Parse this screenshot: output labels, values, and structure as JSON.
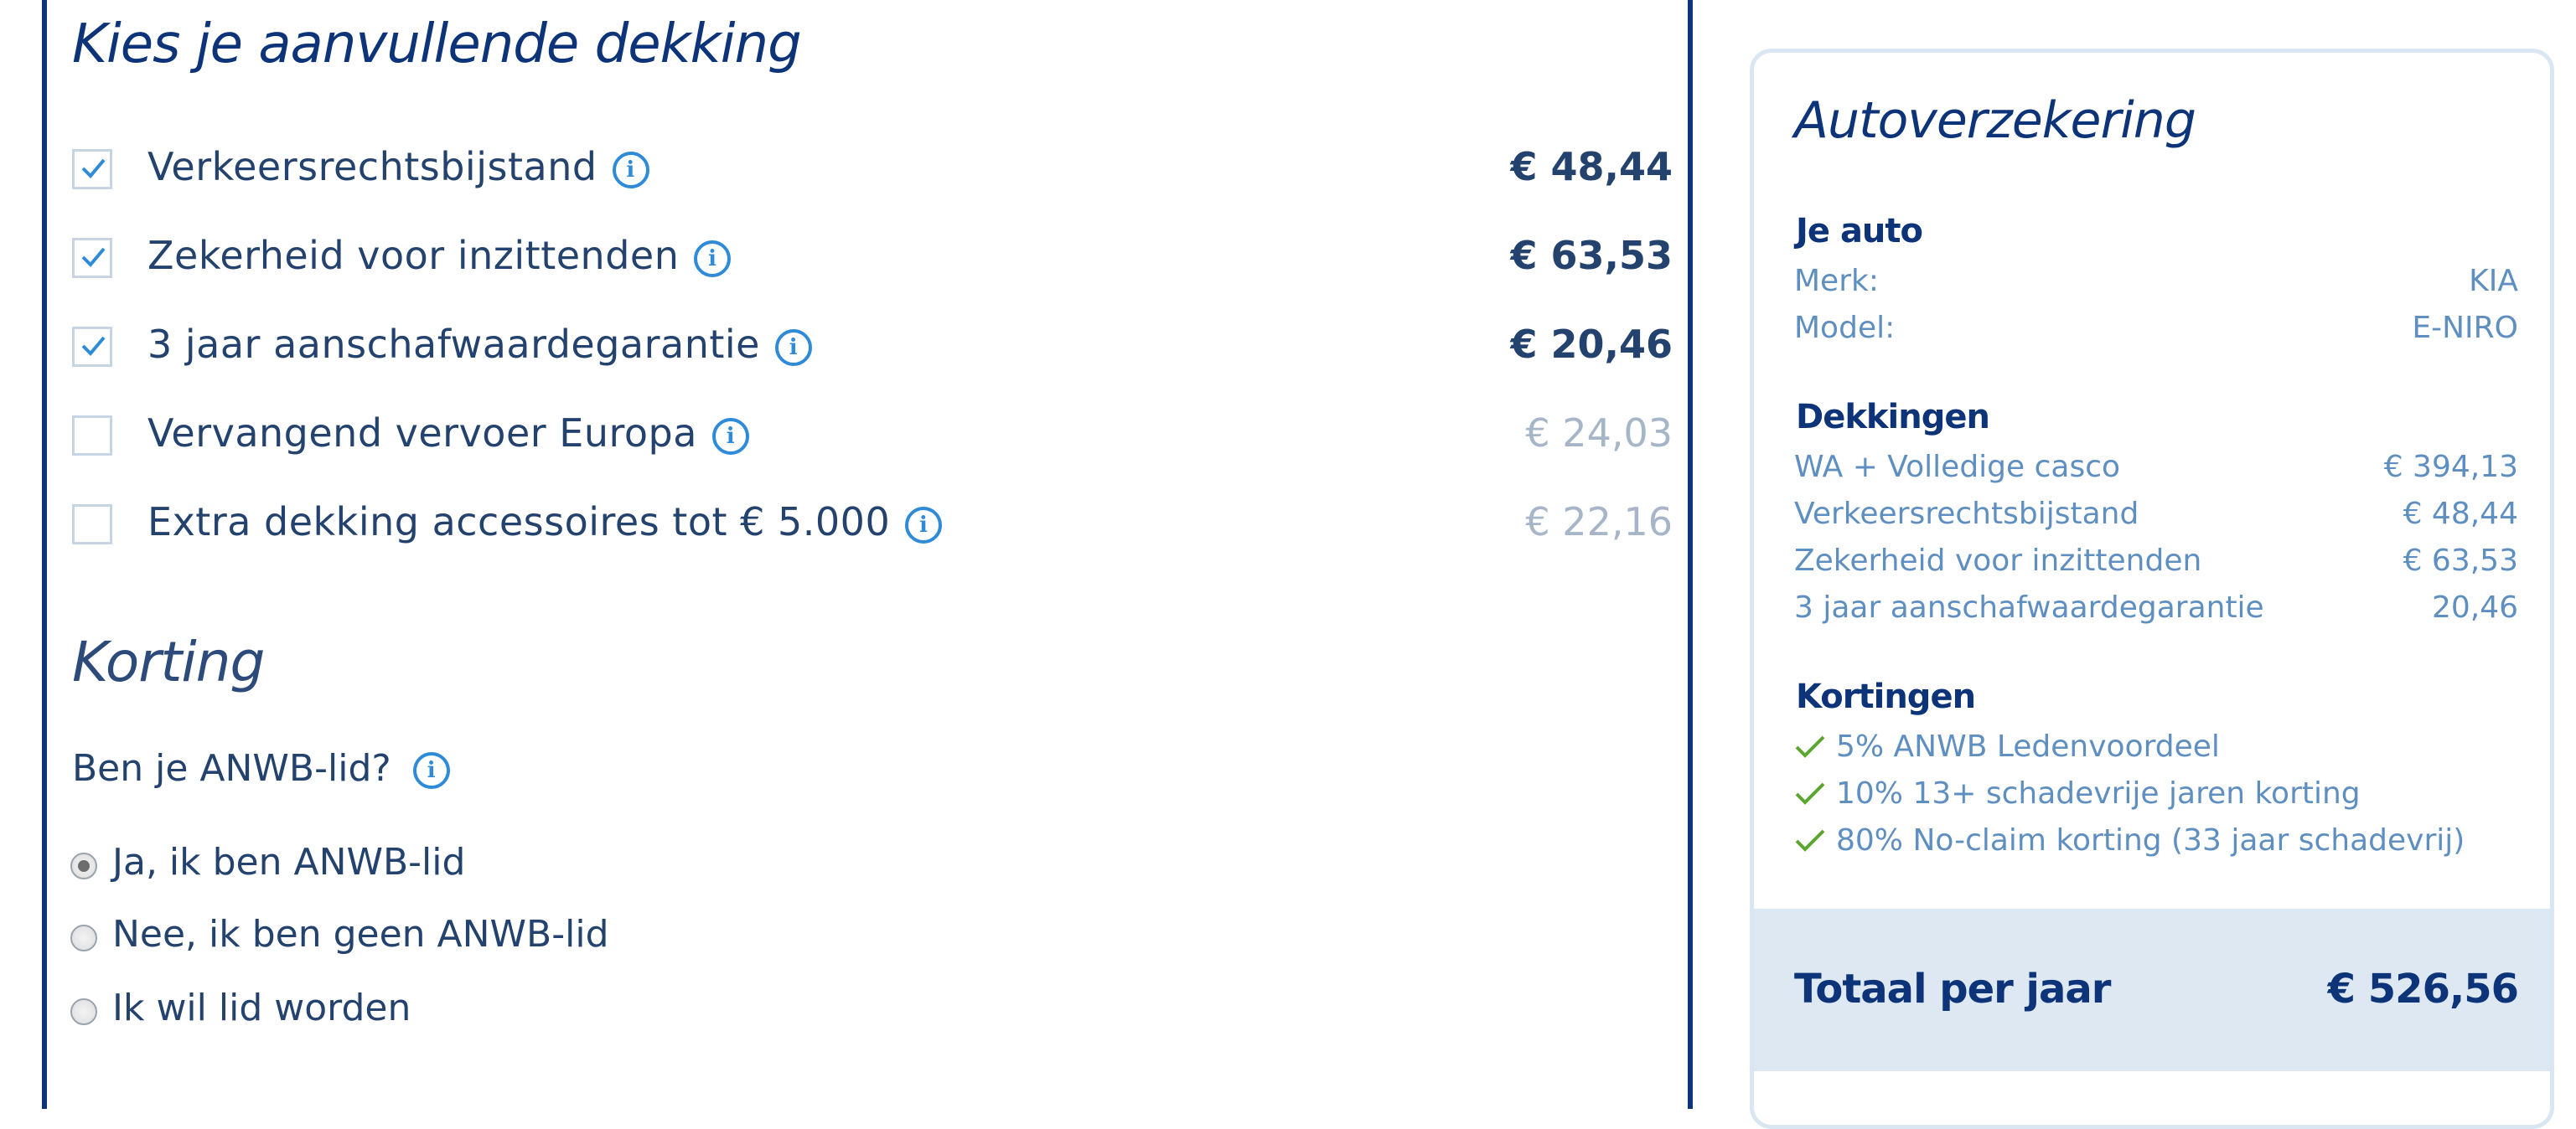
{
  "coverage_section": {
    "title": "Kies je aanvullende dekking",
    "items": [
      {
        "label": "Verkeersrechtsbijstand",
        "price": "€ 48,44",
        "checked": true
      },
      {
        "label": "Zekerheid voor inzittenden",
        "price": "€ 63,53",
        "checked": true
      },
      {
        "label": "3 jaar aanschafwaardegarantie",
        "price": "€ 20,46",
        "checked": true
      },
      {
        "label": "Vervangend vervoer Europa",
        "price": "€ 24,03",
        "checked": false
      },
      {
        "label": "Extra dekking accessoires tot € 5.000",
        "price": "€ 22,16",
        "checked": false
      }
    ]
  },
  "discount_section": {
    "title": "Korting",
    "question": "Ben je ANWB-lid?",
    "options": [
      {
        "label": "Ja, ik ben ANWB-lid",
        "selected": true
      },
      {
        "label": "Nee, ik ben geen ANWB-lid",
        "selected": false
      },
      {
        "label": "Ik wil lid worden",
        "selected": false
      }
    ]
  },
  "summary": {
    "title": "Autoverzekering",
    "car": {
      "heading": "Je auto",
      "rows": [
        {
          "label": "Merk:",
          "value": "KIA"
        },
        {
          "label": "Model:",
          "value": "E-NIRO"
        }
      ]
    },
    "coverages": {
      "heading": "Dekkingen",
      "rows": [
        {
          "label": "WA + Volledige casco",
          "value": "€ 394,13"
        },
        {
          "label": "Verkeersrechtsbijstand",
          "value": "€ 48,44"
        },
        {
          "label": "Zekerheid voor inzittenden",
          "value": "€ 63,53"
        },
        {
          "label": "3 jaar aanschafwaardegarantie",
          "value": "20,46"
        }
      ]
    },
    "discounts": {
      "heading": "Kortingen",
      "items": [
        "5% ANWB Ledenvoordeel",
        "10% 13+ schadevrije jaren korting",
        "80% No-claim korting (33 jaar schadevrij)"
      ]
    },
    "total": {
      "label": "Totaal per jaar",
      "value": "€ 526,56"
    }
  },
  "icons": {
    "info": "info-circle-icon",
    "check": "checkmark-icon"
  },
  "colors": {
    "brand_blue": "#0d3378",
    "text_blue": "#24426e",
    "info_blue": "#2f8bd7",
    "light_text": "#5f8fc0",
    "check_green": "#5aa62f",
    "total_band": "#dde8f2",
    "inactive_price": "#a6b5c8"
  }
}
